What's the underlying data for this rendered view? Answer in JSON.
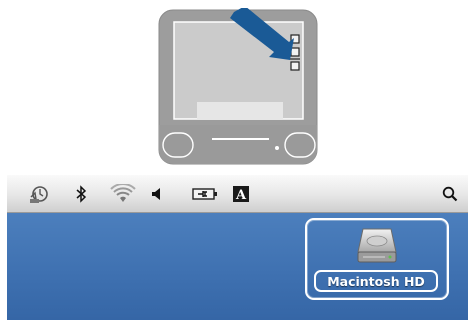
{
  "menubar": {
    "items": [
      {
        "icon": "time-machine-icon"
      },
      {
        "icon": "bluetooth-icon"
      },
      {
        "icon": "wifi-icon"
      },
      {
        "icon": "volume-icon"
      },
      {
        "icon": "battery-icon"
      },
      {
        "icon": "input-menu-icon",
        "glyph": "A"
      },
      {
        "icon": "spotlight-search-icon"
      }
    ]
  },
  "desktop": {
    "drive": {
      "label": "Macintosh HD",
      "icon": "hard-drive-icon",
      "selected": true
    }
  },
  "illustration": {
    "arrow_target": "menu-bar-extras",
    "colors": {
      "bezel": "#9d9d9d",
      "screen": "#cccccc",
      "arrow": "#1a5a96"
    }
  },
  "colors": {
    "desktop": "#3e70b0",
    "menubar": "#e4e4e4",
    "selection": "#ffffff"
  }
}
